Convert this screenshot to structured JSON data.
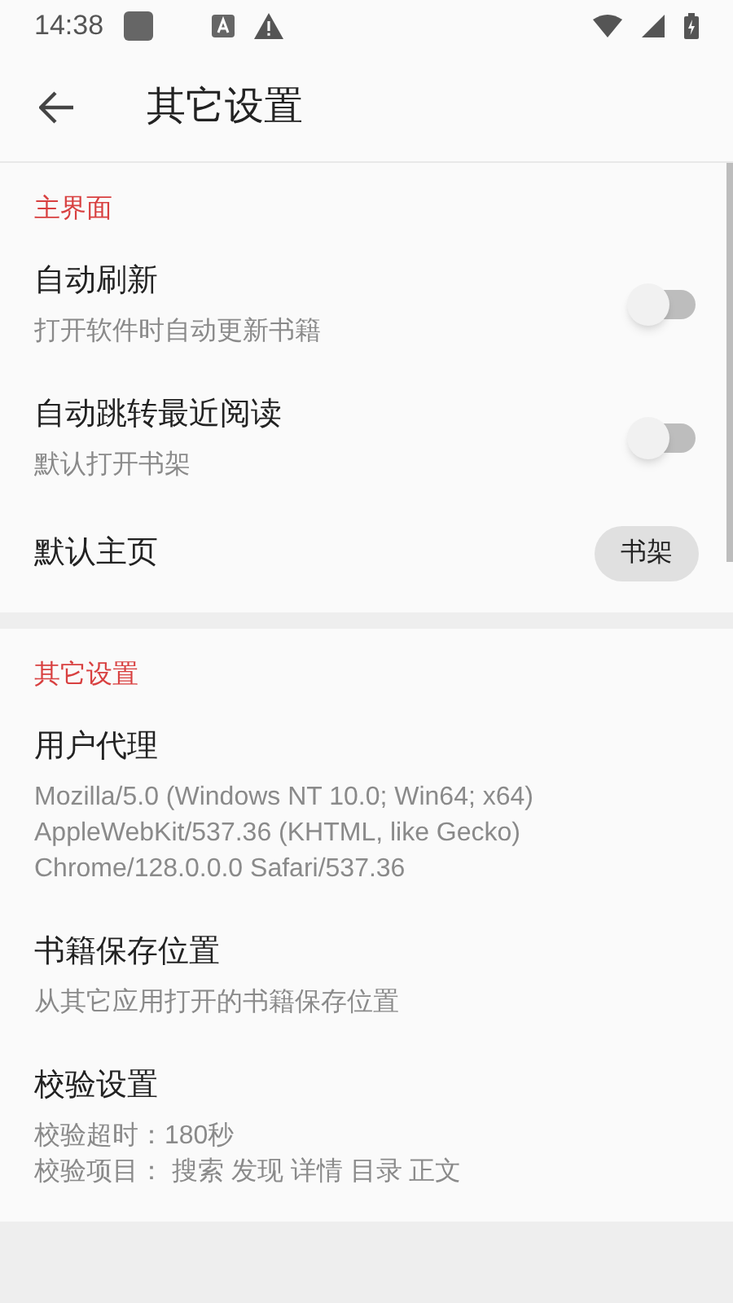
{
  "status_bar": {
    "time": "14:38"
  },
  "app_bar": {
    "title": "其它设置"
  },
  "sections": [
    {
      "header": "主界面",
      "items": [
        {
          "kind": "switch",
          "title": "自动刷新",
          "summary": [
            "打开软件时自动更新书籍"
          ],
          "on": false
        },
        {
          "kind": "switch",
          "title": "自动跳转最近阅读",
          "summary": [
            "默认打开书架"
          ],
          "on": false
        },
        {
          "kind": "chip",
          "title": "默认主页",
          "value": "书架"
        }
      ]
    },
    {
      "header": "其它设置",
      "items": [
        {
          "kind": "text",
          "title": "用户代理",
          "summary": [
            "Mozilla/5.0 (Windows NT 10.0; Win64; x64) AppleWebKit/537.36 (KHTML, like Gecko) Chrome/128.0.0.0 Safari/537.36"
          ]
        },
        {
          "kind": "text",
          "title": "书籍保存位置",
          "summary": [
            "从其它应用打开的书籍保存位置"
          ]
        },
        {
          "kind": "text",
          "title": "校验设置",
          "summary": [
            "校验超时：180秒",
            "校验项目： 搜索 发现 详情 目录 正文"
          ]
        }
      ]
    }
  ]
}
